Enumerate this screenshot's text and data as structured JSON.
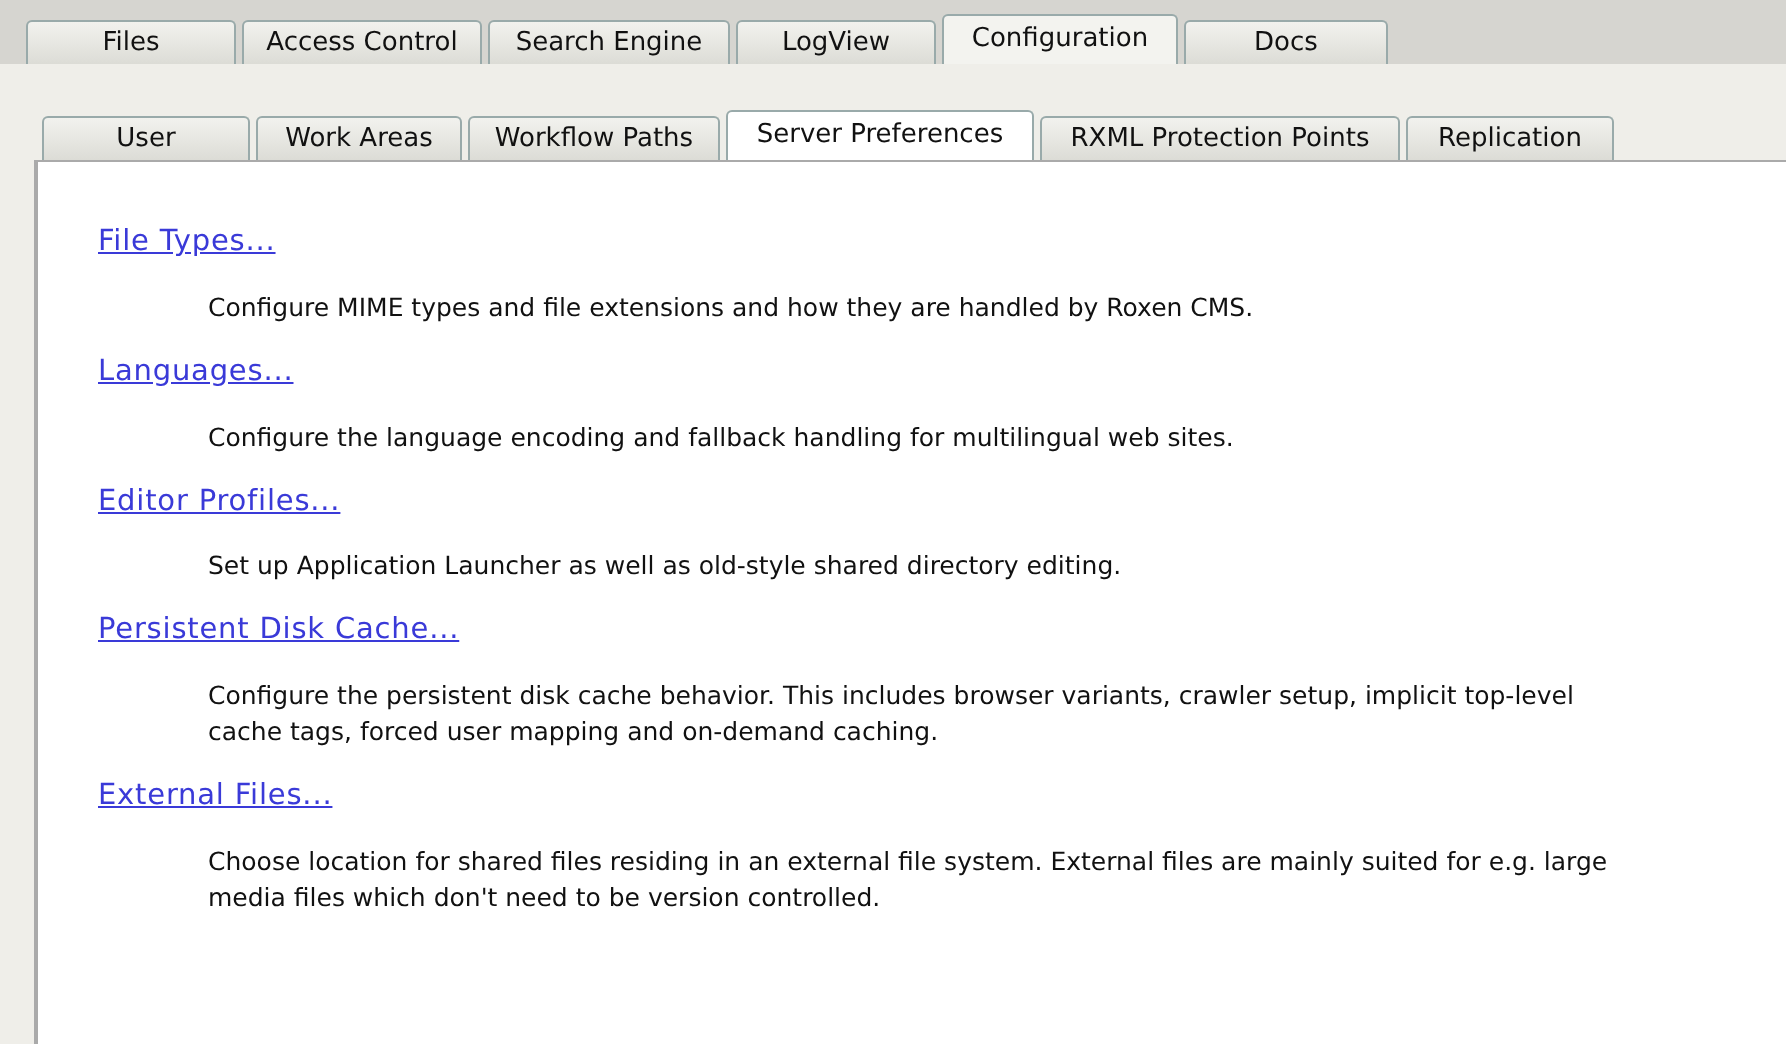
{
  "main_tabs": [
    {
      "label": "Files",
      "selected": false
    },
    {
      "label": "Access Control",
      "selected": false
    },
    {
      "label": "Search Engine",
      "selected": false
    },
    {
      "label": "LogView",
      "selected": false
    },
    {
      "label": "Configuration",
      "selected": true
    },
    {
      "label": "Docs",
      "selected": false
    }
  ],
  "sub_tabs": [
    {
      "label": "User",
      "selected": false
    },
    {
      "label": "Work Areas",
      "selected": false
    },
    {
      "label": "Workflow Paths",
      "selected": false
    },
    {
      "label": "Server Preferences",
      "selected": true
    },
    {
      "label": "RXML Protection Points",
      "selected": false
    },
    {
      "label": "Replication",
      "selected": false
    }
  ],
  "sections": [
    {
      "title": "File Types...",
      "description": "Configure MIME types and file extensions and how they are handled by Roxen CMS."
    },
    {
      "title": "Languages...",
      "description": "Configure the language encoding and fallback handling for multilingual web sites."
    },
    {
      "title": "Editor Profiles...",
      "description": "Set up Application Launcher as well as old-style shared directory editing."
    },
    {
      "title": "Persistent Disk Cache...",
      "description": "Configure the persistent disk cache behavior. This includes browser variants, crawler setup, implicit top-level cache tags, forced user mapping and on-demand caching."
    },
    {
      "title": "External Files...",
      "description": "Choose location for shared files residing in an external file system. External files are mainly suited for e.g. large media files which don't need to be version controlled."
    }
  ]
}
